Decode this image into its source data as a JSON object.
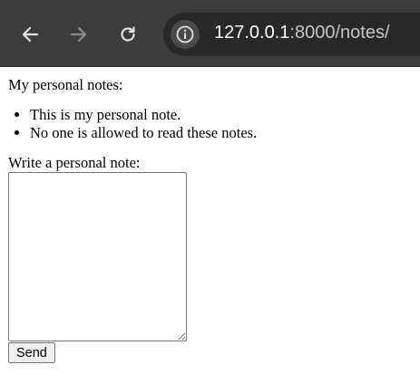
{
  "browser": {
    "url_host": "127.0.0.1",
    "url_rest": ":8000/notes/",
    "icons": {
      "back": "back-arrow-icon",
      "forward": "forward-arrow-icon",
      "reload": "reload-icon",
      "site_info": "info-icon"
    }
  },
  "page": {
    "heading": "My personal notes:",
    "notes": [
      "This is my personal note.",
      "No one is allowed to read these notes."
    ],
    "form": {
      "label": "Write a personal note:",
      "textarea_value": "",
      "send_label": "Send"
    }
  }
}
